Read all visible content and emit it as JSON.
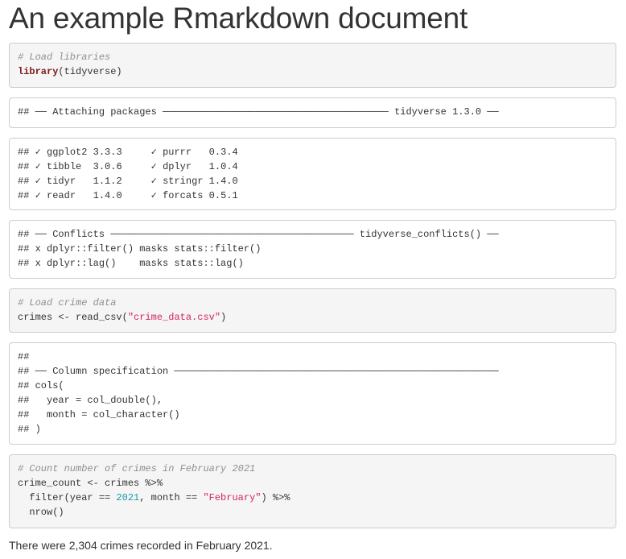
{
  "title": "An example Rmarkdown document",
  "chunks": {
    "load_libraries": {
      "comment": "# Load libraries",
      "fn": "library",
      "rest": "(tidyverse)"
    },
    "attach_output": {
      "line1": "## ── Attaching packages ─────────────────────────────────────── tidyverse 1.3.0 ──"
    },
    "packages_output": {
      "lines": [
        "## ✓ ggplot2 3.3.3     ✓ purrr   0.3.4",
        "## ✓ tibble  3.0.6     ✓ dplyr   1.0.4",
        "## ✓ tidyr   1.1.2     ✓ stringr 1.4.0",
        "## ✓ readr   1.4.0     ✓ forcats 0.5.1"
      ]
    },
    "conflicts_output": {
      "lines": [
        "## ── Conflicts ────────────────────────────────────────── tidyverse_conflicts() ──",
        "## x dplyr::filter() masks stats::filter()",
        "## x dplyr::lag()    masks stats::lag()"
      ]
    },
    "load_data": {
      "comment": "# Load crime data",
      "pre": "crimes <- read_csv(",
      "string": "\"crime_data.csv\"",
      "post": ")"
    },
    "colspec_output": {
      "lines": [
        "##",
        "## ── Column specification ────────────────────────────────────────────────────────",
        "## cols(",
        "##   year = col_double(),",
        "##   month = col_character()",
        "## )"
      ]
    },
    "count_crimes": {
      "comment": "# Count number of crimes in February 2021",
      "line2": "crime_count <- crimes %>%",
      "line3_pre": "  filter(year == ",
      "line3_num": "2021",
      "line3_mid": ", month == ",
      "line3_str": "\"February\"",
      "line3_post": ") %>%",
      "line4": "  nrow()"
    }
  },
  "result_text": "There were 2,304 crimes recorded in February 2021."
}
